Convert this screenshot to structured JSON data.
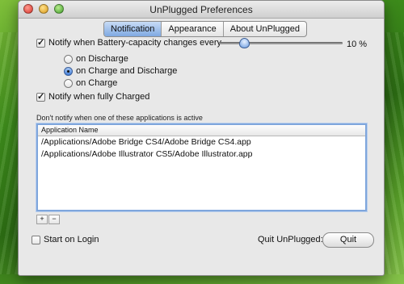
{
  "window": {
    "title": "UnPlugged Preferences"
  },
  "tabs": [
    {
      "label": "Notification",
      "active": true
    },
    {
      "label": "Appearance",
      "active": false
    },
    {
      "label": "About UnPlugged",
      "active": false
    }
  ],
  "notify_capacity": {
    "label": "Notify when Battery-capacity changes every",
    "checked": true
  },
  "slider": {
    "value_percent": 10,
    "value_label": "10 %"
  },
  "options": [
    {
      "label": "on Discharge",
      "selected": false
    },
    {
      "label": "on Charge and Discharge",
      "selected": true
    },
    {
      "label": "on Charge",
      "selected": false
    }
  ],
  "notify_full": {
    "label": "Notify when fully Charged",
    "checked": true
  },
  "apps": {
    "note": "Don't notify when one of these applications is active",
    "column_header": "Application Name",
    "items": [
      "/Applications/Adobe Bridge CS4/Adobe Bridge CS4.app",
      "/Applications/Adobe Illustrator CS5/Adobe Illustrator.app"
    ],
    "add_label": "+",
    "remove_label": "−"
  },
  "start_on_login": {
    "label": "Start on Login",
    "checked": false
  },
  "quit": {
    "label": "Quit UnPlugged:",
    "button": "Quit"
  },
  "icons": {
    "close": "close-icon",
    "minimize": "minimize-icon",
    "zoom": "zoom-icon"
  }
}
